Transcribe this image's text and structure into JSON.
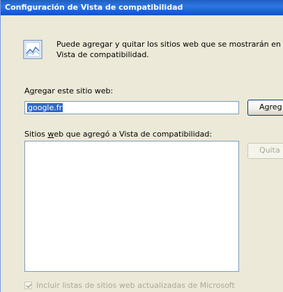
{
  "window": {
    "title": "Configuración de Vista de compatibilidad"
  },
  "info": {
    "icon": "compatibility-view-icon",
    "line1": "Puede agregar y quitar los sitios web que se mostrarán en",
    "line2": "Vista de compatibilidad."
  },
  "add_site": {
    "label_prefix": "A",
    "label_mnemonic": "g",
    "label_suffix": "regar este sitio web:",
    "input_value": "google.fr",
    "button_label_first": "A",
    "button_label_mnemonic": "g",
    "button_label_rest": "reg"
  },
  "site_list": {
    "label_prefix": "Sitios ",
    "label_mnemonic": "w",
    "label_suffix": "eb que agregó a Vista de compatibilidad:",
    "items": [],
    "remove_button_label": "Quita"
  },
  "options": {
    "include_updated_lists_label": "Incluir listas de sitios web actualizadas de Microsoft",
    "include_updated_lists_checked": true,
    "include_updated_lists_enabled": false
  },
  "colors": {
    "titlebar": "#2e76e4",
    "dialog_bg": "#ece9d8",
    "selection": "#316ac5",
    "disabled_text": "#aca899"
  }
}
